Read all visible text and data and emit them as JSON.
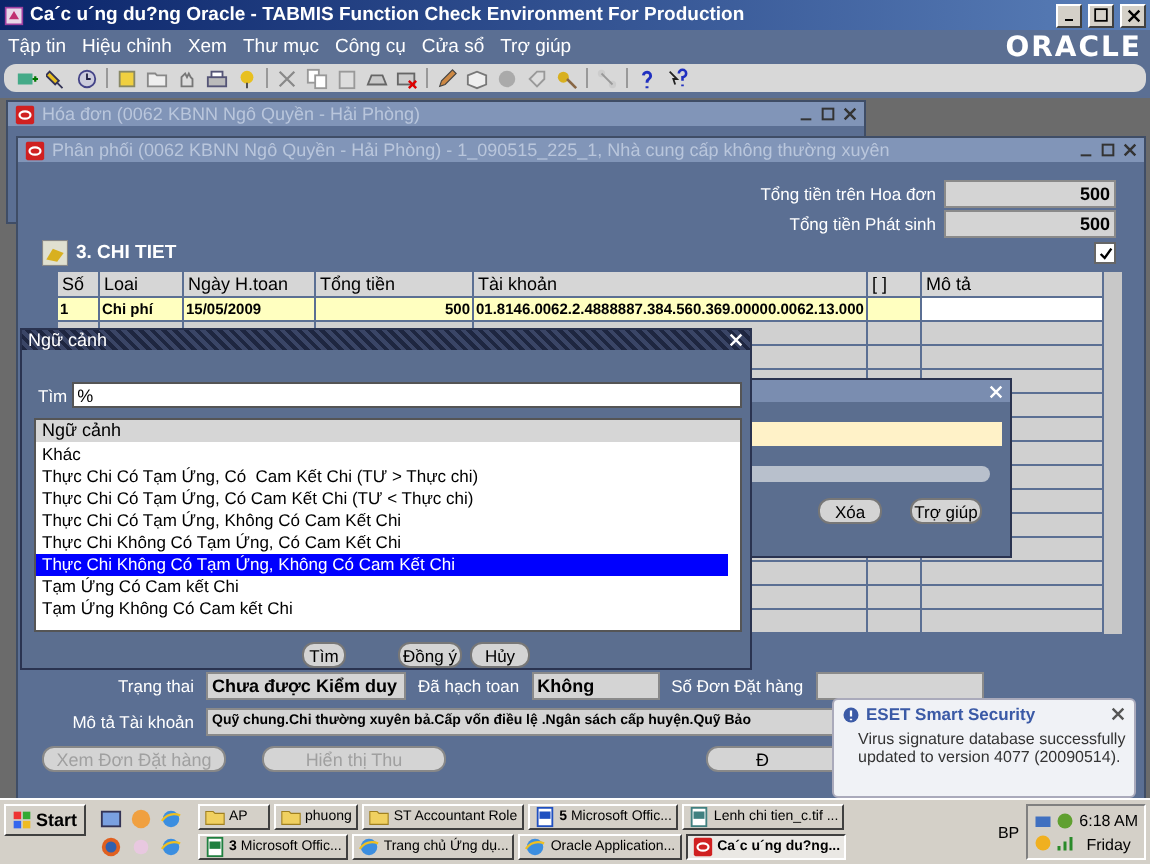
{
  "window": {
    "title": "Ca´c u´ng du?ng Oracle - TABMIS Function Check Environment For Production"
  },
  "menu": [
    "Tập tin",
    "Hiệu chỉnh",
    "Xem",
    "Thư mục",
    "Công cụ",
    "Cửa sổ",
    "Trợ giúp"
  ],
  "logo": "ORACLE",
  "mdi_windows": [
    {
      "title": "Hóa đơn (0062 KBNN Ngô Quyền - Hải Phòng)"
    },
    {
      "title": "Phân phối (0062 KBNN Ngô Quyền - Hải Phòng) - 1_090515_225_1, Nhà cung cấp không thường xuyên"
    }
  ],
  "totals": [
    {
      "label": "Tổng tiền trên Hoa đơn",
      "value": "500"
    },
    {
      "label": "Tổng tiền Phát sinh",
      "value": "500"
    }
  ],
  "section": {
    "title": "3. CHI TIET",
    "checked": true
  },
  "table": {
    "columns": [
      "Số",
      "Loai",
      "Ngày H.toan",
      "Tổng tiền",
      "Tài khoản",
      "[ ]",
      "Mô tả"
    ],
    "rows": [
      {
        "selected": true,
        "cells": [
          "1",
          "Chi phí",
          "15/05/2009",
          "500",
          "01.8146.0062.2.4888887.384.560.369.00000.0062.13.000"
        ]
      }
    ]
  },
  "status_fields": [
    {
      "label": "Trạng thai",
      "value": "Chưa được Kiểm duy"
    },
    {
      "label": "Đã hạch toan",
      "value": "Không"
    },
    {
      "label": "Số Đơn Đặt hàng"
    }
  ],
  "account_description": {
    "label": "Mô tả Tài khoản",
    "value": "Quỹ chung.Chi thường xuyên bả.Cấp vốn điều lệ .Ngân sách cấp huyện.Quỹ Bảo"
  },
  "buttons": [
    {
      "label": "Xem Đơn Đặt hàng",
      "disabled": true
    },
    {
      "label": "Hiển thị Thu",
      "disabled": true
    },
    {
      "label": "Đ",
      "disabled": false
    }
  ],
  "back_dialog": {
    "buttons": [
      "Xóa",
      "Trợ giúp"
    ]
  },
  "context_dialog": {
    "title": "Ngữ cảnh",
    "search_label": "Tìm",
    "search_value": "%",
    "list_header": "Ngữ cảnh",
    "items": [
      {
        "label": "Khác",
        "selected": false
      },
      {
        "label": "Thực Chi Có Tạm Ứng, Có  Cam Kết Chi (TƯ > Thực chi)",
        "selected": false
      },
      {
        "label": "Thực Chi Có Tạm Ứng, Có Cam Kết Chi (TƯ < Thực chi)",
        "selected": false
      },
      {
        "label": "Thực Chi Có Tạm Ứng, Không Có Cam Kết Chi",
        "selected": false
      },
      {
        "label": "Thực Chi Không Có Tạm Ứng, Có Cam Kết Chi",
        "selected": false
      },
      {
        "label": "Thực Chi Không Có Tạm Ứng, Không Có Cam Kết Chi",
        "selected": true
      },
      {
        "label": "Tạm Ứng Có Cam kết Chi",
        "selected": false
      },
      {
        "label": "Tạm Ứng Không Có Cam kết Chi",
        "selected": false
      }
    ],
    "buttons": [
      "Tìm",
      "Đồng ý",
      "Hủy"
    ]
  },
  "notification": {
    "title": "ESET Smart Security",
    "message": "Virus signature database successfully updated to version 4077 (20090514)."
  },
  "taskbar": {
    "start": "Start",
    "task_rows": [
      [
        {
          "label": "AP",
          "active": false
        },
        {
          "label": "phuong",
          "active": false
        },
        {
          "label": "ST Accountant Role",
          "active": false
        },
        {
          "label": "**5** Microsoft Offic...",
          "active": false
        },
        {
          "label": "Lenh chi tien_c.tif ...",
          "active": false
        }
      ],
      [
        {
          "label": "**3** Microsoft Offic...",
          "active": false
        },
        {
          "label": "Trang chủ Ứng dụ...",
          "active": false
        },
        {
          "label": "Oracle Application...",
          "active": false
        },
        {
          "label": "Ca´c u´ng du?ng...",
          "active": true
        }
      ]
    ],
    "tray_label": "BP",
    "time": "6:18 AM",
    "day": "Friday"
  }
}
